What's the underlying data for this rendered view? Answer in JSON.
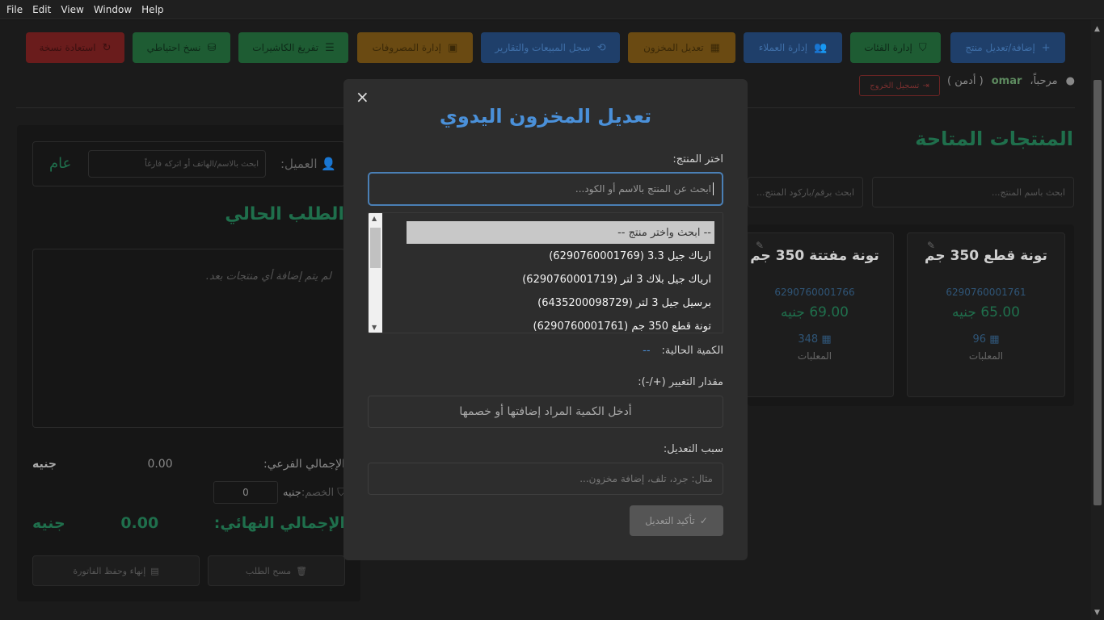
{
  "menubar": [
    "File",
    "Edit",
    "View",
    "Window",
    "Help"
  ],
  "topbar": [
    {
      "label": "إضافة/تعديل منتج",
      "icon": "+",
      "bg": "#1f3f6a",
      "fg": "#3f6fa8"
    },
    {
      "label": "إدارة الفئات",
      "icon": "⛉",
      "bg": "#1e5c33",
      "fg": "#0d2a18"
    },
    {
      "label": "إدارة العملاء",
      "icon": "👥",
      "bg": "#1f3f6a",
      "fg": "#3f6fa8"
    },
    {
      "label": "تعديل المخزون",
      "icon": "▦",
      "bg": "#6a4a12",
      "fg": "#3a2807"
    },
    {
      "label": "سجل المبيعات والتقارير",
      "icon": "⟲",
      "bg": "#1f3f6a",
      "fg": "#3f6fa8"
    },
    {
      "label": "إدارة المصروفات",
      "icon": "▣",
      "bg": "#6a4a12",
      "fg": "#3a2807"
    },
    {
      "label": "تفريغ الكاشيرات",
      "icon": "☰",
      "bg": "#1e5c33",
      "fg": "#0d2a18"
    },
    {
      "label": "نسخ احتياطي",
      "icon": "⛁",
      "bg": "#1e5c33",
      "fg": "#0d2a18"
    },
    {
      "label": "استعادة نسخة",
      "icon": "↻",
      "bg": "#6a1c1c",
      "fg": "#3a0f0f"
    }
  ],
  "user": {
    "greeting": "مرحباً،",
    "name": "omar",
    "role": "( أدمن )",
    "logout": "تسجيل الخروج"
  },
  "products": {
    "title": "المنتجات المتاحة",
    "search_name_placeholder": "ابحث باسم المنتج...",
    "search_code_placeholder": "ابحث برقم/باركود المنتج...",
    "cards": [
      {
        "name": "تونة قطع 350 جم",
        "barcode": "6290760001761",
        "price": "65.00 جنيه",
        "stock": "96",
        "stock_label": "المعلبات"
      },
      {
        "name": "تونة مفتتة 350 جم",
        "barcode": "6290760001766",
        "price": "69.00 جنيه",
        "stock": "348",
        "stock_label": "المعلبات"
      }
    ]
  },
  "order": {
    "customer_label": "العميل:",
    "customer_placeholder": "ابحث بالاسم/الهاتف أو اتركه فارغاً",
    "customer_value": "عام",
    "title": "الطلب الحالي",
    "empty_msg": "لم يتم إضافة أي منتجات بعد.",
    "subtotal_label": "الإجمالي الفرعي:",
    "subtotal_value": "0.00",
    "currency": "جنيه",
    "discount_label": "الخصم:",
    "discount_value": "0",
    "total_label": "الإجمالي النهائي:",
    "total_value": "0.00",
    "clear_btn": "مسح الطلب",
    "finish_btn": "إنهاء وحفظ الفاتورة"
  },
  "modal": {
    "close": "×",
    "title": "تعديل المخزون اليدوي",
    "select_label": "اختر المنتج:",
    "search_value": "ابحث عن المنتج بالاسم أو الكود...",
    "options": [
      "-- ابحث واختر منتج --",
      "ارياك جيل 3.3 (6290760001769)",
      "ارياك جيل بلاك 3 لتر (6290760001719)",
      "برسيل جيل 3 لتر (6435200098729)",
      "تونة قطع 350 جم (6290760001761)"
    ],
    "current_qty_label": "الكمية الحالية:",
    "current_qty_value": "--",
    "change_label": "مقدار التغيير (+/-):",
    "change_placeholder": "أدخل الكمية المراد إضافتها أو خصمها",
    "reason_label": "سبب التعديل:",
    "reason_placeholder": "مثال: جرد، تلف، إضافة مخزون...",
    "confirm": "تأكيد التعديل"
  },
  "colors": {
    "accent_green": "#1f6f4c",
    "accent_blue": "#4a90d9",
    "modal_bg": "#2d2d2d"
  }
}
